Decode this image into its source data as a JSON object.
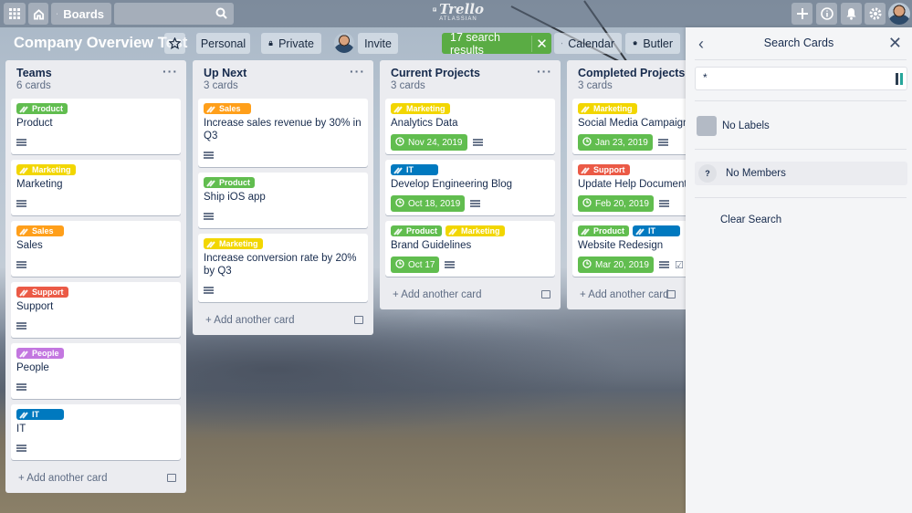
{
  "header": {
    "boards_label": "Boards",
    "logo_text": "Trello",
    "logo_sub": "ATLASSIAN"
  },
  "board": {
    "title": "Company Overview Test",
    "visibility_team": "Personal",
    "visibility": "Private",
    "invite_label": "Invite",
    "search_results": "17 search results",
    "calendar_label": "Calendar",
    "butler_label": "Butler"
  },
  "colors": {
    "green": "#61bd4f",
    "yellow": "#f2d600",
    "orange": "#ff9f1a",
    "red": "#eb5a46",
    "purple": "#c377e0",
    "blue": "#0079bf"
  },
  "lists": [
    {
      "name": "Teams",
      "count": "6 cards",
      "add_label": "Add another card",
      "cards": [
        {
          "title": "Product",
          "labels": [
            {
              "text": "Product",
              "color": "#61bd4f"
            }
          ]
        },
        {
          "title": "Marketing",
          "labels": [
            {
              "text": "Marketing",
              "color": "#f2d600"
            }
          ]
        },
        {
          "title": "Sales",
          "labels": [
            {
              "text": "Sales",
              "color": "#ff9f1a"
            }
          ]
        },
        {
          "title": "Support",
          "labels": [
            {
              "text": "Support",
              "color": "#eb5a46"
            }
          ]
        },
        {
          "title": "People",
          "labels": [
            {
              "text": "People",
              "color": "#c377e0"
            }
          ]
        },
        {
          "title": "IT",
          "labels": [
            {
              "text": "IT",
              "color": "#0079bf"
            }
          ]
        }
      ]
    },
    {
      "name": "Up Next",
      "count": "3 cards",
      "add_label": "Add another card",
      "cards": [
        {
          "title": "Increase sales revenue by 30% in Q3",
          "labels": [
            {
              "text": "Sales",
              "color": "#ff9f1a"
            }
          ]
        },
        {
          "title": "Ship iOS app",
          "labels": [
            {
              "text": "Product",
              "color": "#61bd4f"
            }
          ]
        },
        {
          "title": "Increase conversion rate by 20% by Q3",
          "labels": [
            {
              "text": "Marketing",
              "color": "#f2d600"
            }
          ]
        }
      ]
    },
    {
      "name": "Current Projects",
      "count": "3 cards",
      "add_label": "Add another card",
      "cards": [
        {
          "title": "Analytics Data",
          "labels": [
            {
              "text": "Marketing",
              "color": "#f2d600"
            }
          ],
          "due": "Nov 24, 2019"
        },
        {
          "title": "Develop Engineering Blog",
          "labels": [
            {
              "text": "IT",
              "color": "#0079bf"
            }
          ],
          "due": "Oct 18, 2019"
        },
        {
          "title": "Brand Guidelines",
          "labels": [
            {
              "text": "Product",
              "color": "#61bd4f"
            },
            {
              "text": "Marketing",
              "color": "#f2d600"
            }
          ],
          "due": "Oct 17"
        }
      ]
    },
    {
      "name": "Completed Projects",
      "count": "3 cards",
      "add_label": "Add another card",
      "cards": [
        {
          "title": "Social Media Campaign",
          "labels": [
            {
              "text": "Marketing",
              "color": "#f2d600"
            }
          ],
          "due": "Jan 23, 2019"
        },
        {
          "title": "Update Help Documentation",
          "labels": [
            {
              "text": "Support",
              "color": "#eb5a46"
            }
          ],
          "due": "Feb 20, 2019"
        },
        {
          "title": "Website Redesign",
          "labels": [
            {
              "text": "Product",
              "color": "#61bd4f"
            },
            {
              "text": "IT",
              "color": "#0079bf"
            }
          ],
          "due": "Mar 20, 2019",
          "checklist": true
        }
      ]
    }
  ],
  "panel": {
    "title": "Search Cards",
    "search_value": "*",
    "no_labels": "No Labels",
    "no_members": "No Members",
    "members_icon": "?",
    "clear_search": "Clear Search"
  }
}
